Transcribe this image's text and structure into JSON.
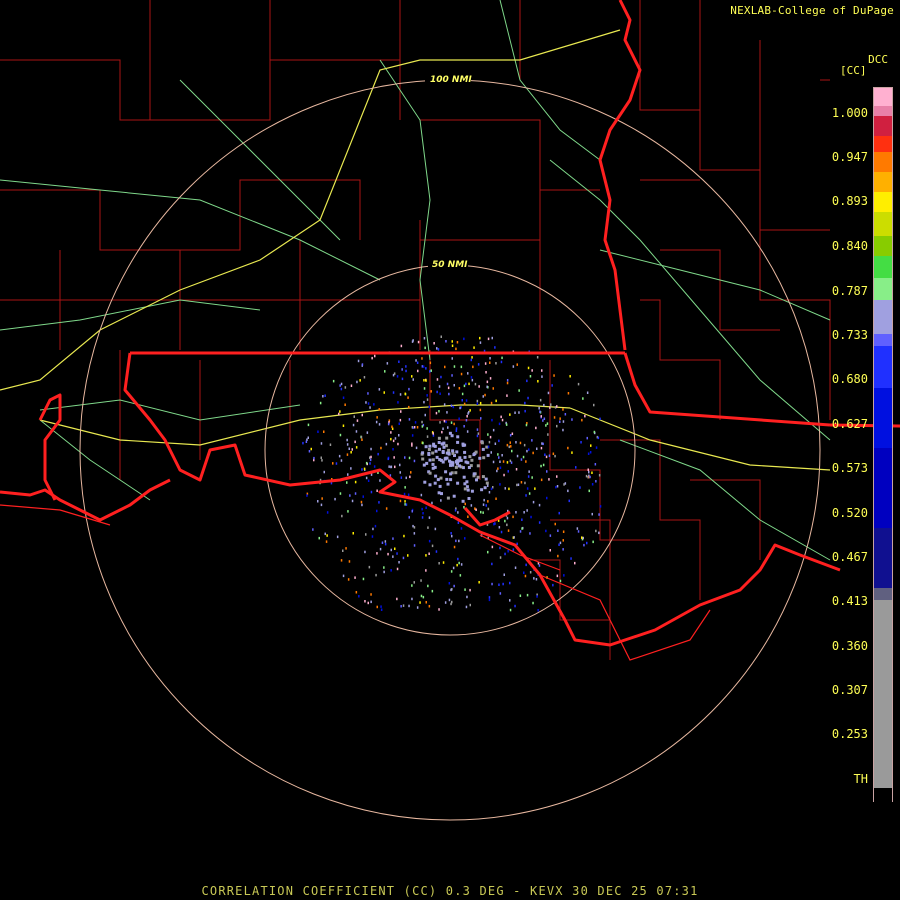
{
  "header": {
    "credit": "NEXLAB-College of DuPage",
    "logo": "DCC",
    "units": "[CC]"
  },
  "map": {
    "rings": [
      {
        "label": "100 NMI"
      },
      {
        "label": "50 NMI"
      }
    ]
  },
  "legend": {
    "ticks": [
      "1.000",
      "0.947",
      "0.893",
      "0.840",
      "0.787",
      "0.733",
      "0.680",
      "0.627",
      "0.573",
      "0.520",
      "0.467",
      "0.413",
      "0.360",
      "0.307",
      "0.253",
      "TH"
    ],
    "colors": {
      "background": "#000000",
      "state_border": "#ff2020",
      "county_border": "#b01818",
      "highway_interstate": "#e8e850",
      "highway_us": "#7fd88a",
      "range_ring": "#e8b8a0",
      "tick_text": "#ffff55"
    }
  },
  "footer": {
    "caption": "CORRELATION COEFFICIENT (CC) 0.3 DEG - KEVX 30 DEC 25 07:31"
  }
}
